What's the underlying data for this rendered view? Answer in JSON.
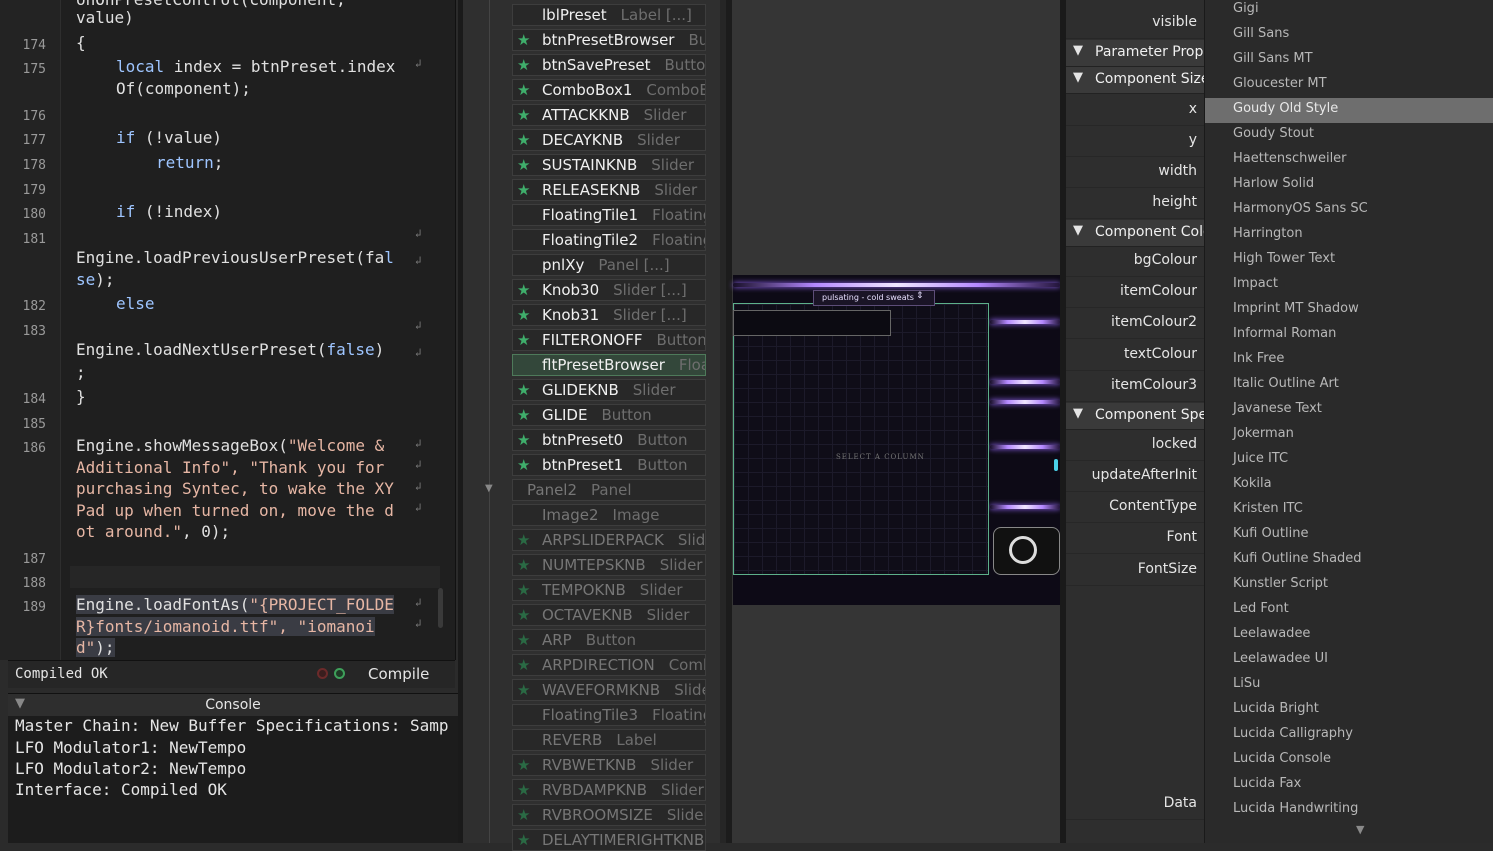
{
  "editor": {
    "header_text": "onOnPresetControl(component, ",
    "lines": [
      {
        "num": "",
        "text": "value)"
      },
      {
        "num": "174",
        "text": "{"
      },
      {
        "num": "175",
        "kw": "local",
        "text": " index = btnPreset.indexOf(component);"
      },
      {
        "num": "176",
        "text": ""
      },
      {
        "num": "177",
        "kw": "if",
        "text": " (!value)"
      },
      {
        "num": "178",
        "kw": "return",
        "text": ";"
      },
      {
        "num": "179",
        "text": ""
      },
      {
        "num": "180",
        "kw": "if",
        "text": " (!index)"
      },
      {
        "num": "181",
        "text": ""
      },
      {
        "num": "",
        "text": "Engine.loadPreviousUserPreset(fa",
        "kw_tail": "lse",
        "tail": ");"
      },
      {
        "num": "182",
        "kw": "else",
        "text": ""
      },
      {
        "num": "183",
        "text": ""
      },
      {
        "num": "",
        "text": "Engine.loadNextUserPreset(",
        "kw_tail": "false",
        "tail": ")"
      },
      {
        "num": "",
        "text": ";"
      },
      {
        "num": "184",
        "text": "}"
      },
      {
        "num": "185",
        "text": ""
      },
      {
        "num": "186",
        "text": "Engine.showMessageBox(",
        "str": "\"Welcome & Additional Info\", \"Thank you for purchasing Syntec, to wake the XY Pad up when turned on, move the dot around.\"",
        "tail": ", 0);"
      },
      {
        "num": "187",
        "text": ""
      },
      {
        "num": "188",
        "text": ""
      },
      {
        "num": "189",
        "text": "Engine.loadFontAs(",
        "str": "\"{PROJECT_FOLDER}fonts/iomanoid.ttf\", \"iomanoid\"",
        "tail": ");"
      }
    ]
  },
  "status": {
    "text": "Compiled OK",
    "compile_label": "Compile"
  },
  "console": {
    "title": "Console",
    "lines": [
      {
        "prefix": "Master Chain:",
        "text": " New Buffer Specifications: Samp"
      },
      {
        "prefix": "LFO Modulator1:",
        "text": " NewTempo"
      },
      {
        "prefix": "LFO Modulator2:",
        "text": " NewTempo"
      },
      {
        "prefix": "Interface:",
        "text": " Compiled OK"
      }
    ]
  },
  "tree": {
    "items": [
      {
        "name": "lblPreset",
        "type": "Label [...]",
        "star": false,
        "dim": false
      },
      {
        "name": "btnPresetBrowser",
        "type": "Butt",
        "star": true,
        "dim": false
      },
      {
        "name": "btnSavePreset",
        "type": "Button",
        "star": true,
        "dim": false
      },
      {
        "name": "ComboBox1",
        "type": "ComboBo",
        "star": true,
        "dim": false
      },
      {
        "name": "ATTACKKNB",
        "type": "Slider",
        "star": true,
        "dim": false
      },
      {
        "name": "DECAYKNB",
        "type": "Slider",
        "star": true,
        "dim": false
      },
      {
        "name": "SUSTAINKNB",
        "type": "Slider",
        "star": true,
        "dim": false
      },
      {
        "name": "RELEASEKNB",
        "type": "Slider",
        "star": true,
        "dim": false
      },
      {
        "name": "FloatingTile1",
        "type": "FloatingT",
        "star": false,
        "dim": false
      },
      {
        "name": "FloatingTile2",
        "type": "FloatingT",
        "star": false,
        "dim": false
      },
      {
        "name": "pnlXy",
        "type": "Panel [...]",
        "star": false,
        "dim": false
      },
      {
        "name": "Knob30",
        "type": "Slider [...]",
        "star": true,
        "dim": false
      },
      {
        "name": "Knob31",
        "type": "Slider [...]",
        "star": true,
        "dim": false
      },
      {
        "name": "FILTERONOFF",
        "type": "Button",
        "star": true,
        "dim": false
      },
      {
        "name": "fltPresetBrowser",
        "type": "Float",
        "star": false,
        "dim": false,
        "selected": true
      },
      {
        "name": "GLIDEKNB",
        "type": "Slider",
        "star": true,
        "dim": false
      },
      {
        "name": "GLIDE",
        "type": "Button",
        "star": true,
        "dim": false
      },
      {
        "name": "btnPreset0",
        "type": "Button",
        "star": true,
        "dim": false
      },
      {
        "name": "btnPreset1",
        "type": "Button",
        "star": true,
        "dim": false
      },
      {
        "name": "Panel2",
        "type": "Panel",
        "star": false,
        "dim": true,
        "parent": true
      },
      {
        "name": "Image2",
        "type": "Image",
        "star": false,
        "dim": true
      },
      {
        "name": "ARPSLIDERPACK",
        "type": "Slide",
        "star": true,
        "dim": true
      },
      {
        "name": "NUMTEPSKNB",
        "type": "Slider",
        "star": true,
        "dim": true
      },
      {
        "name": "TEMPOKNB",
        "type": "Slider",
        "star": true,
        "dim": true
      },
      {
        "name": "OCTAVEKNB",
        "type": "Slider",
        "star": true,
        "dim": true
      },
      {
        "name": "ARP",
        "type": "Button",
        "star": true,
        "dim": true
      },
      {
        "name": "ARPDIRECTION",
        "type": "Comb",
        "star": true,
        "dim": true
      },
      {
        "name": "WAVEFORMKNB",
        "type": "Slide",
        "star": true,
        "dim": true
      },
      {
        "name": "FloatingTile3",
        "type": "FloatingT",
        "star": false,
        "dim": true
      },
      {
        "name": "REVERB",
        "type": "Label",
        "star": false,
        "dim": true
      },
      {
        "name": "RVBWETKNB",
        "type": "Slider",
        "star": true,
        "dim": true
      },
      {
        "name": "RVBDAMPKNB",
        "type": "Slider",
        "star": true,
        "dim": true
      },
      {
        "name": "RVBROOMSIZE",
        "type": "Slider",
        "star": true,
        "dim": true
      },
      {
        "name": "DELAYTIMERIGHTKNB",
        "type": "",
        "star": true,
        "dim": true
      }
    ]
  },
  "canvas": {
    "preset_name": "pulsating - cold sweats",
    "browser_caption": "SELECT A COLUMN"
  },
  "properties": {
    "rows": [
      {
        "kind": "prop",
        "label": "visible"
      },
      {
        "kind": "header",
        "label": "Parameter Properties"
      },
      {
        "kind": "header",
        "label": "Component Size"
      },
      {
        "kind": "prop",
        "label": "x"
      },
      {
        "kind": "prop",
        "label": "y"
      },
      {
        "kind": "prop",
        "label": "width"
      },
      {
        "kind": "prop",
        "label": "height"
      },
      {
        "kind": "header",
        "label": "Component Colours"
      },
      {
        "kind": "prop",
        "label": "bgColour"
      },
      {
        "kind": "prop",
        "label": "itemColour"
      },
      {
        "kind": "prop",
        "label": "itemColour2"
      },
      {
        "kind": "prop",
        "label": "textColour"
      },
      {
        "kind": "prop",
        "label": "itemColour3"
      },
      {
        "kind": "header",
        "label": "Component Specific"
      },
      {
        "kind": "prop",
        "label": "locked"
      },
      {
        "kind": "prop",
        "label": "updateAfterInit"
      },
      {
        "kind": "prop",
        "label": "ContentType"
      },
      {
        "kind": "prop",
        "label": "Font"
      },
      {
        "kind": "prop",
        "label": "FontSize"
      },
      {
        "kind": "prop",
        "label": "Data"
      }
    ]
  },
  "font_list": {
    "items": [
      "Gigi",
      "Gill Sans",
      "Gill Sans MT",
      "Gloucester MT",
      "Goudy Old Style",
      "Goudy Stout",
      "Haettenschweiler",
      "Harlow Solid",
      "HarmonyOS Sans SC",
      "Harrington",
      "High Tower Text",
      "Impact",
      "Imprint MT Shadow",
      "Informal Roman",
      "Ink Free",
      "Italic Outline Art",
      "Javanese Text",
      "Jokerman",
      "Juice ITC",
      "Kokila",
      "Kristen ITC",
      "Kufi Outline",
      "Kufi Outline Shaded",
      "Kunstler Script",
      "Led Font",
      "Leelawadee",
      "Leelawadee UI",
      "LiSu",
      "Lucida Bright",
      "Lucida Calligraphy",
      "Lucida Console",
      "Lucida Fax",
      "Lucida Handwriting"
    ],
    "selected": "Goudy Old Style"
  },
  "colors": {
    "accent_green": "#3fae6b",
    "selected_row": "#33473a",
    "keyword": "#9ec5ff",
    "string": "#e6b6a4"
  }
}
